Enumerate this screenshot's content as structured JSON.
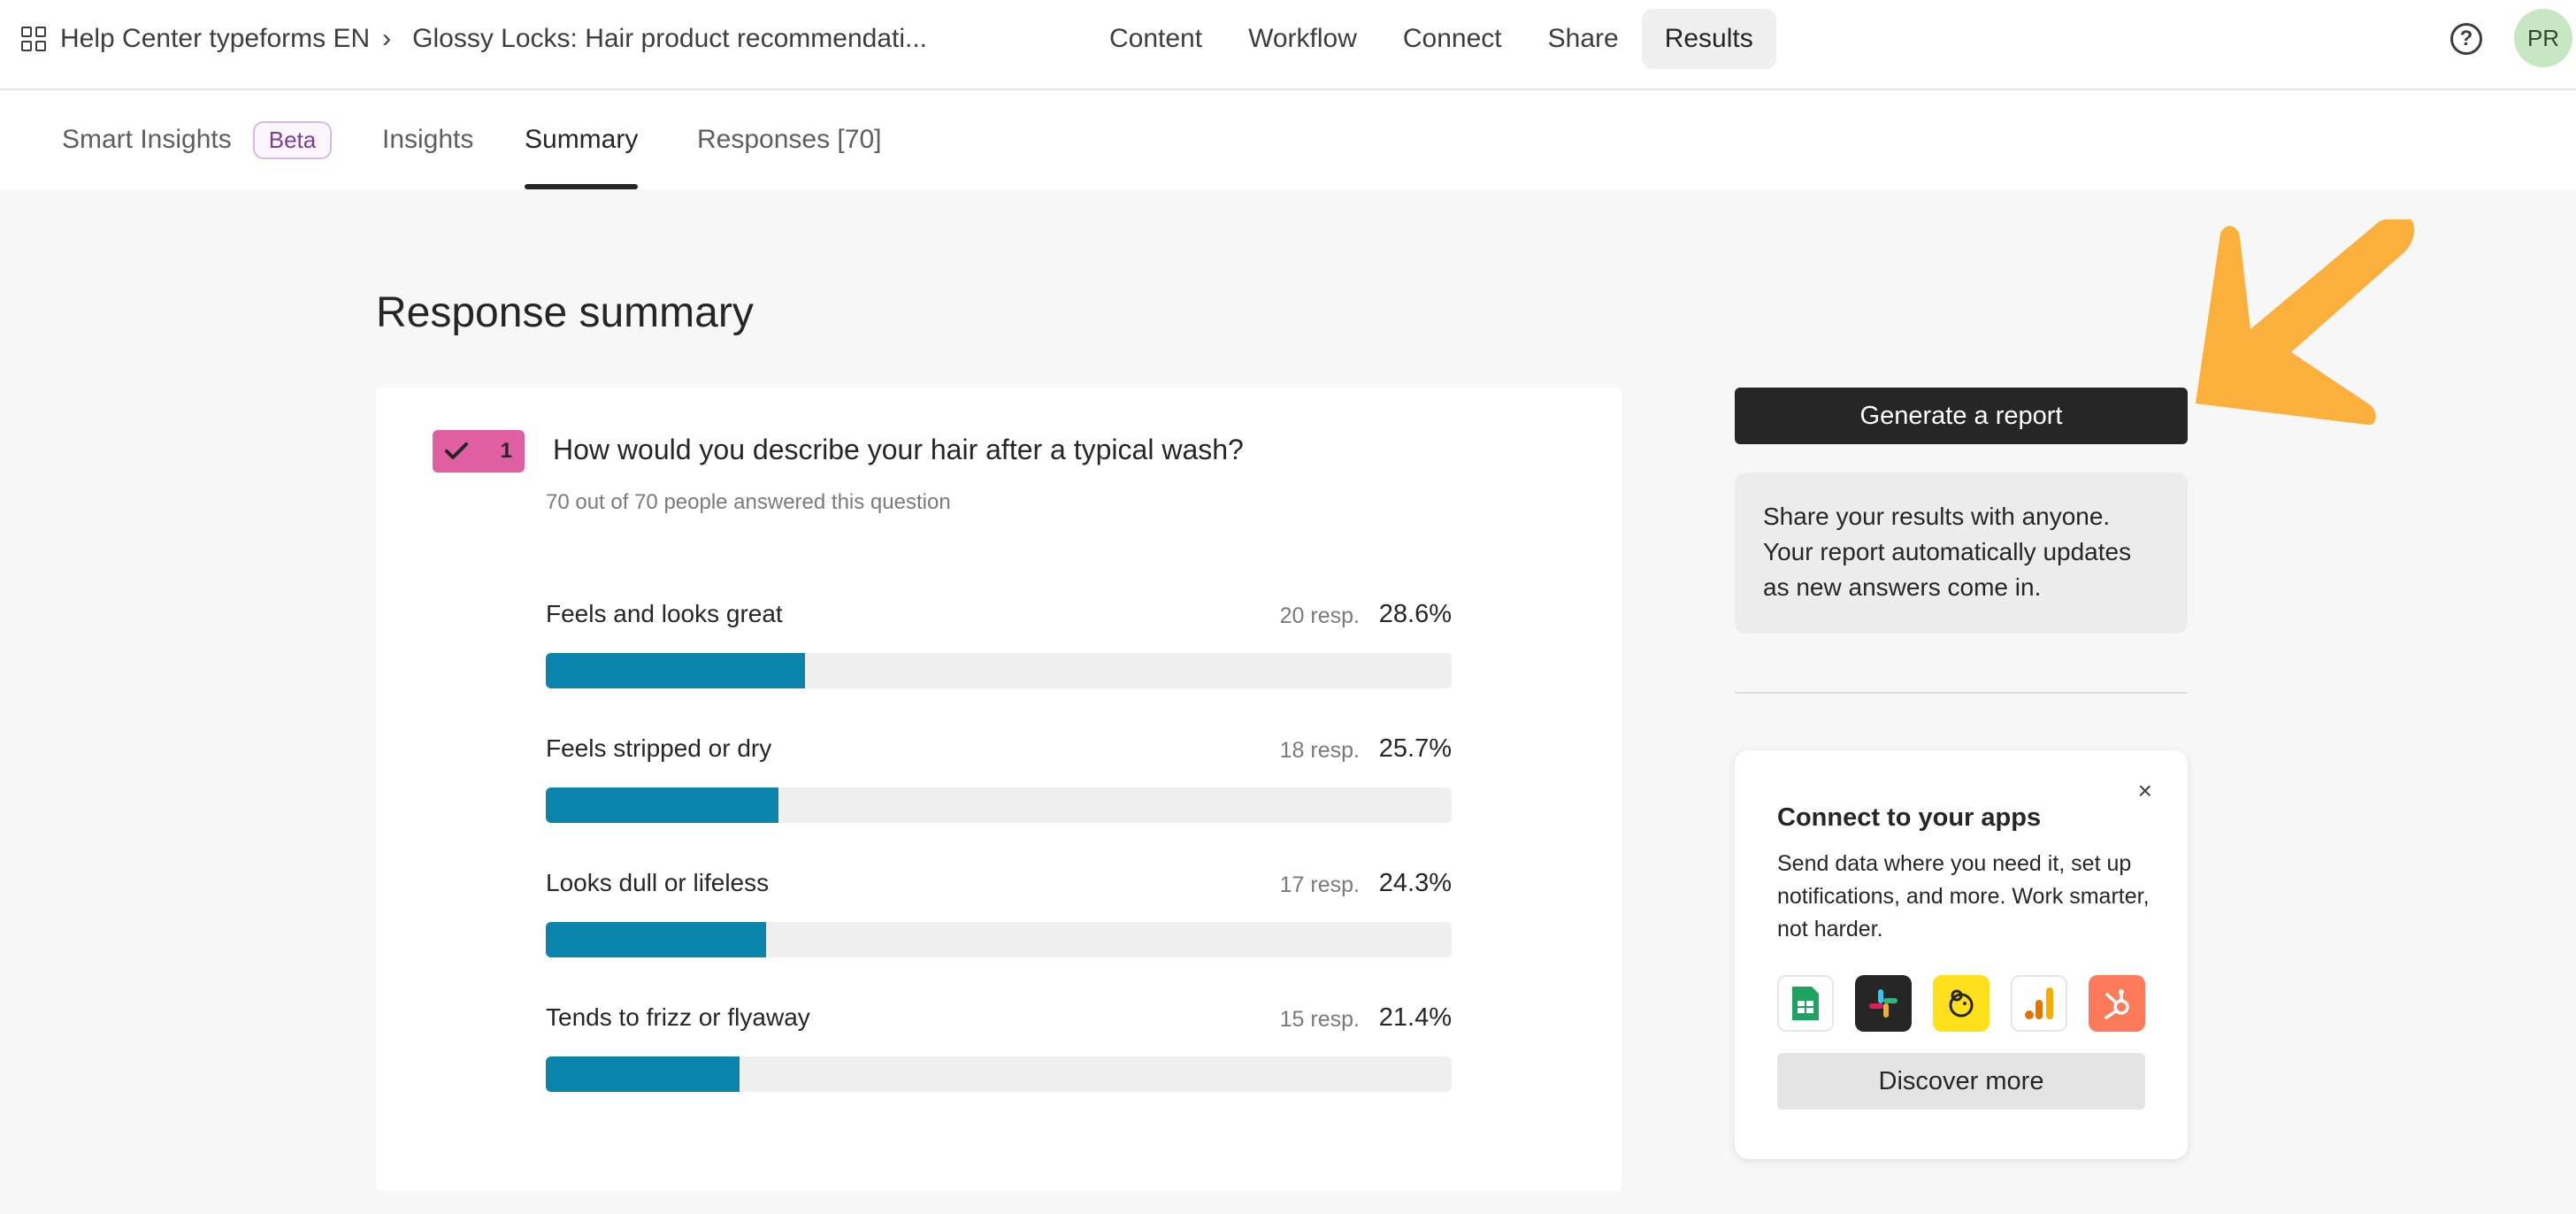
{
  "breadcrumb": {
    "workspace": "Help Center typeforms EN",
    "separator": "›",
    "form": "Glossy Locks: Hair product recommendati..."
  },
  "nav": [
    {
      "label": "Content"
    },
    {
      "label": "Workflow"
    },
    {
      "label": "Connect"
    },
    {
      "label": "Share"
    },
    {
      "label": "Results",
      "active": true
    }
  ],
  "help": {
    "glyph": "?"
  },
  "avatar": {
    "initials": "PR",
    "color": "#c7e6c2"
  },
  "subtabs": {
    "smart_insights": "Smart Insights",
    "beta": "Beta",
    "insights": "Insights",
    "summary": "Summary",
    "responses": "Responses [70]"
  },
  "page_title": "Response summary",
  "question": {
    "number": "1",
    "type_icon": "check-icon",
    "badge_color": "#e05fa2",
    "title": "How would you describe your hair after a typical wash?",
    "subtitle": "70 out of 70 people answered this question",
    "bar_color": "#0b84ad",
    "answers": [
      {
        "label": "Feels and looks great",
        "resp": "20 resp.",
        "pct": "28.6%",
        "value": 28.6
      },
      {
        "label": "Feels stripped or dry",
        "resp": "18 resp.",
        "pct": "25.7%",
        "value": 25.7
      },
      {
        "label": "Looks dull or lifeless",
        "resp": "17 resp.",
        "pct": "24.3%",
        "value": 24.3
      },
      {
        "label": "Tends to frizz or flyaway",
        "resp": "15 resp.",
        "pct": "21.4%",
        "value": 21.4
      }
    ]
  },
  "report": {
    "button": "Generate a report",
    "description": "Share your results with anyone. Your report automatically updates as new answers come in."
  },
  "connect": {
    "close": "×",
    "title": "Connect to your apps",
    "description": "Send data where you need it, set up notifications, and more. Work smarter, not harder.",
    "apps": [
      "google-sheets-icon",
      "slack-icon",
      "mailchimp-icon",
      "google-analytics-icon",
      "hubspot-icon"
    ],
    "discover": "Discover more"
  },
  "annotation_arrow_color": "#fbb03b"
}
